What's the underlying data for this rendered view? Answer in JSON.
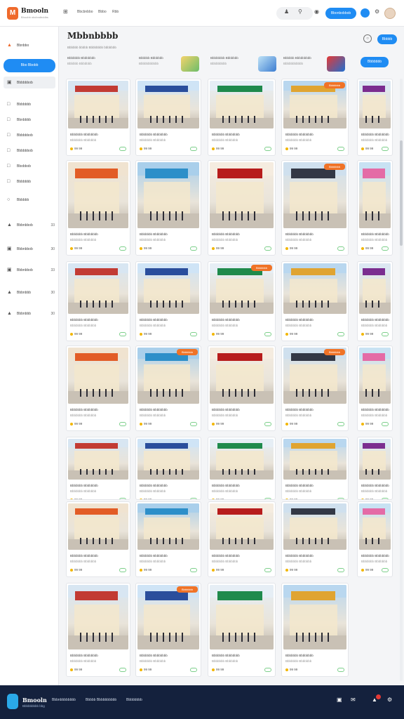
{
  "header": {
    "brand": "Bmooln",
    "brand_sub": "Bhoobb nbcbndbddbs",
    "nav": [
      "Bbcbnbbo",
      "Bbbo",
      "Rbb"
    ],
    "action_button": "Bbonbobbob"
  },
  "sidebar": {
    "primary_button": "Bbo Bbobb",
    "items": [
      {
        "label": "Bbnbbo",
        "icon": "fire-icon",
        "count": ""
      },
      {
        "label": "Bbbbbbob",
        "icon": "store-icon",
        "count": ""
      },
      {
        "label": "Bbbbbbb",
        "icon": "file-icon",
        "count": ""
      },
      {
        "label": "Bbnbbbb",
        "icon": "folder-icon",
        "count": ""
      },
      {
        "label": "Bbbbbbob",
        "icon": "box-icon",
        "count": ""
      },
      {
        "label": "Bbbbbbob",
        "icon": "tag-icon",
        "count": ""
      },
      {
        "label": "Bbobbob",
        "icon": "file-icon",
        "count": ""
      },
      {
        "label": "Bbbbbbb",
        "icon": "users-icon",
        "count": ""
      },
      {
        "label": "Bbbbbb",
        "icon": "cart-icon",
        "count": ""
      },
      {
        "label": "Bbbnbbob",
        "icon": "chart-icon",
        "count": "33"
      },
      {
        "label": "Bbbnbbob",
        "icon": "chart-icon",
        "count": "30"
      },
      {
        "label": "Bbbnbbob",
        "icon": "chart-icon",
        "count": "33"
      },
      {
        "label": "Bbbnbbb",
        "icon": "chart-icon",
        "count": "30"
      },
      {
        "label": "Bbbnbbb",
        "icon": "chart-icon",
        "count": "30"
      }
    ]
  },
  "main": {
    "title": "Mbbnbbbb",
    "subtitle": "Bbbbbb bbbbb Bbbbbbbb bbbbbbb",
    "stats": [
      {
        "a": "Bbbbbbb Bbbbbbbb",
        "b": "Bbbbbb Bbbbbbb"
      },
      {
        "a": "Bbbbbb Bbbbbbb",
        "b": "Bbbbbbbbbbb"
      },
      {
        "a": "Bbbbbbbb Bbbbbbb",
        "b": "Bbbbbbbbb"
      },
      {
        "a": "Bbbbbb Bbbbbbbbb",
        "b": "Bbbbbbbbbbb"
      }
    ],
    "top_button": "Bbbbb",
    "mid_button": "Bbbbbbb",
    "card_badge": "Bbbbbbb",
    "card_title": "Bbbbbbb Bbbbbbbb",
    "card_sub": "Bbbbbbb Bbbbbbb",
    "card_meta": "99  99"
  },
  "footer": {
    "brand": "Bmooln",
    "brand_sub": "Bbbbbbbbb bbg",
    "links": [
      "Bbbnbbbbbbbb",
      "Bbbbb Bbbbbbbbbb",
      "Bbbbbbbb"
    ]
  }
}
